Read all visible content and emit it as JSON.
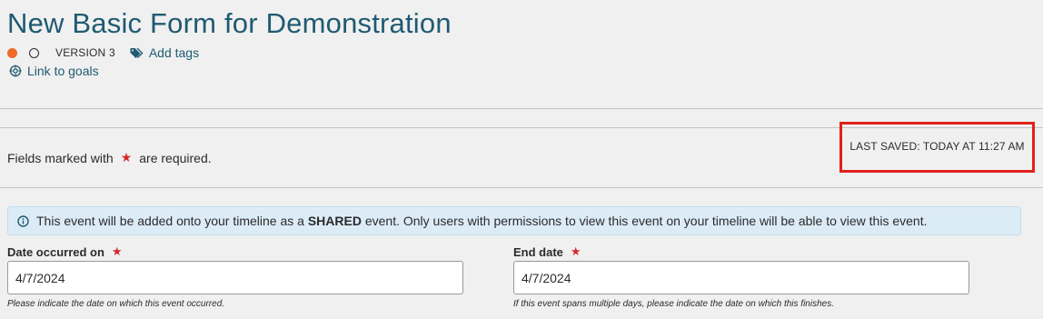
{
  "header": {
    "title": "New Basic Form for Demonstration",
    "version": "VERSION 3",
    "add_tags": "Add tags",
    "link_to_goals": "Link to goals",
    "status_colors": {
      "active": "#ee6a26"
    }
  },
  "form_notice": {
    "required_prefix": "Fields marked with",
    "required_star": "★",
    "required_suffix": "are required.",
    "last_saved": "LAST SAVED: TODAY AT 11:27 AM"
  },
  "info_banner": {
    "text_before": "This event will be added onto your timeline as a ",
    "text_bold": "SHARED",
    "text_after": " event. Only users with permissions to view this event on your timeline will be able to view this event."
  },
  "fields": {
    "date_occurred": {
      "label": "Date occurred on",
      "star": "★",
      "value": "4/7/2024",
      "help": "Please indicate the date on which this event occurred."
    },
    "end_date": {
      "label": "End date",
      "star": "★",
      "value": "4/7/2024",
      "help": "If this event spans multiple days, please indicate the date on which this finishes."
    }
  },
  "colors": {
    "accent": "#1f5a72",
    "required": "#d42a2a",
    "highlight_box": "#e3201c",
    "banner_bg": "#dcecf7"
  }
}
